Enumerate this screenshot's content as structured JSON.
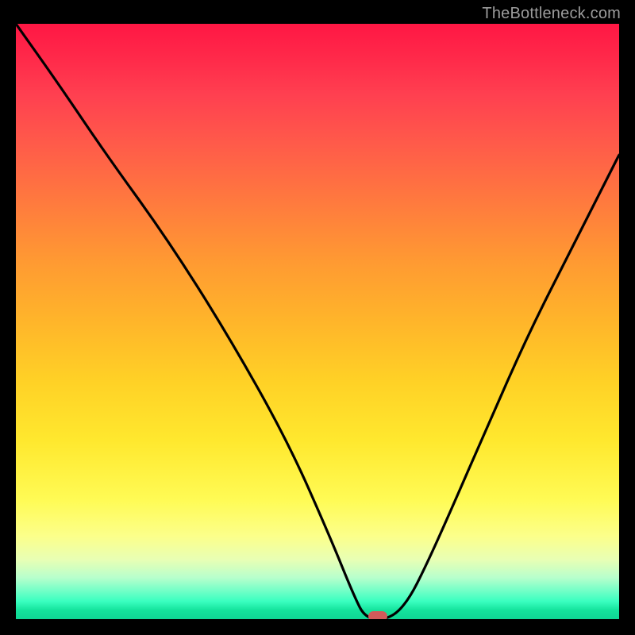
{
  "watermark": "TheBottleneck.com",
  "chart_data": {
    "type": "line",
    "title": "",
    "xlabel": "",
    "ylabel": "",
    "xlim": [
      0,
      100
    ],
    "ylim": [
      0,
      100
    ],
    "series": [
      {
        "name": "curve",
        "x": [
          0,
          7,
          15,
          25,
          35,
          45,
          52,
          56,
          58,
          62,
          65,
          68,
          72,
          78,
          85,
          92,
          100
        ],
        "values": [
          100,
          90,
          78,
          64,
          48,
          30,
          14,
          4,
          0,
          0,
          3,
          9,
          18,
          32,
          48,
          62,
          78
        ]
      }
    ],
    "marker": {
      "x": 60,
      "y": 0
    },
    "background": {
      "type": "vertical-gradient",
      "stops": [
        {
          "pos": 0,
          "color": "#ff1744"
        },
        {
          "pos": 50,
          "color": "#ffb52a"
        },
        {
          "pos": 80,
          "color": "#fffb55"
        },
        {
          "pos": 95,
          "color": "#7affc8"
        },
        {
          "pos": 100,
          "color": "#0fd694"
        }
      ]
    }
  }
}
